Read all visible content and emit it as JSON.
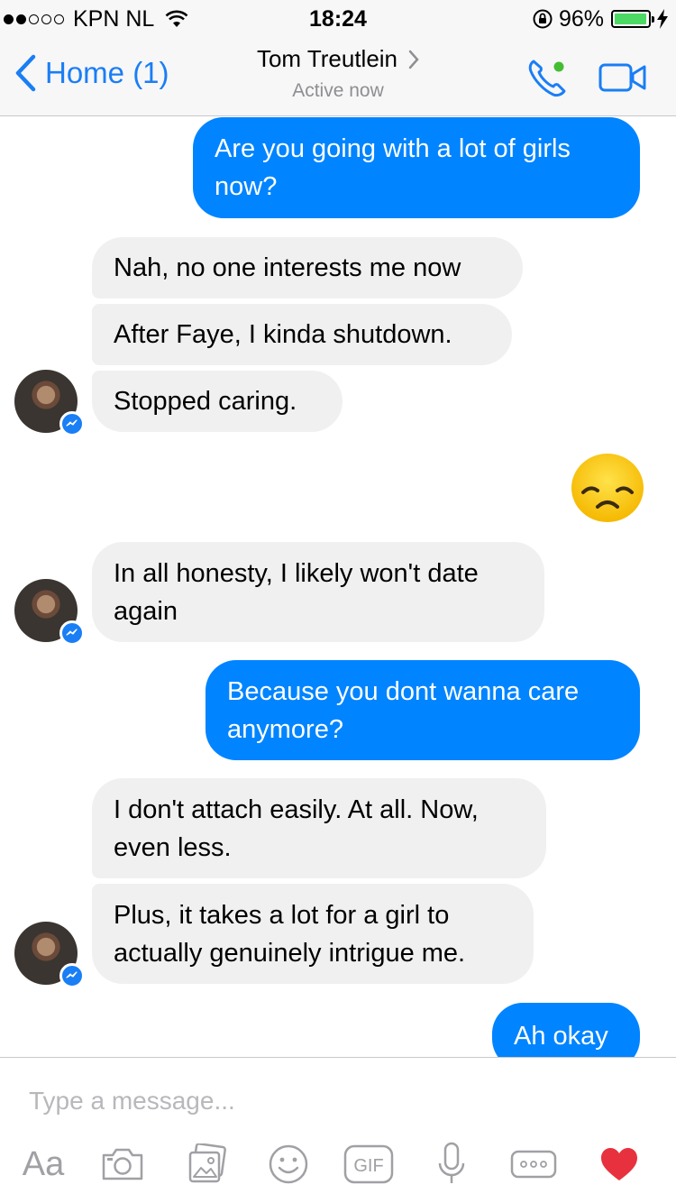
{
  "status_bar": {
    "carrier": "KPN NL",
    "time": "18:24",
    "battery": "96%",
    "battery_level": 0.96,
    "signal_bars": 2
  },
  "nav": {
    "back_label": "Home (1)",
    "contact_name": "Tom Treutlein",
    "status": "Active now",
    "presence_color": "#44bd32",
    "accent": "#1a7ef5"
  },
  "messages": [
    {
      "sender": "me",
      "text": "Are you going with a lot of girls now?"
    },
    {
      "sender": "them",
      "text": "Nah, no one interests me now"
    },
    {
      "sender": "them",
      "text": "After Faye, I kinda shutdown."
    },
    {
      "sender": "them",
      "text": "Stopped caring."
    },
    {
      "sender": "me",
      "emoji": "disappointed-face"
    },
    {
      "sender": "them",
      "text": "In all honesty, I likely won't date again"
    },
    {
      "sender": "me",
      "text": "Because you dont wanna care anymore?"
    },
    {
      "sender": "them",
      "text": "I don't attach easily. At all. Now, even less."
    },
    {
      "sender": "them",
      "text": "Plus, it takes a lot for a girl to actually genuinely intrigue me."
    },
    {
      "sender": "me",
      "text": "Ah okay"
    }
  ],
  "colors": {
    "outgoing_bubble": "#0084ff",
    "incoming_bubble": "#f1f0f0",
    "like_heart": "#e8313e"
  },
  "composer": {
    "placeholder": "Type a message...",
    "value": "",
    "toolbar": {
      "aa_label": "Aa",
      "icons": [
        "camera-icon",
        "photo-gallery-icon",
        "smiley-icon",
        "gif-icon",
        "microphone-icon",
        "more-icon",
        "heart-icon"
      ]
    }
  }
}
